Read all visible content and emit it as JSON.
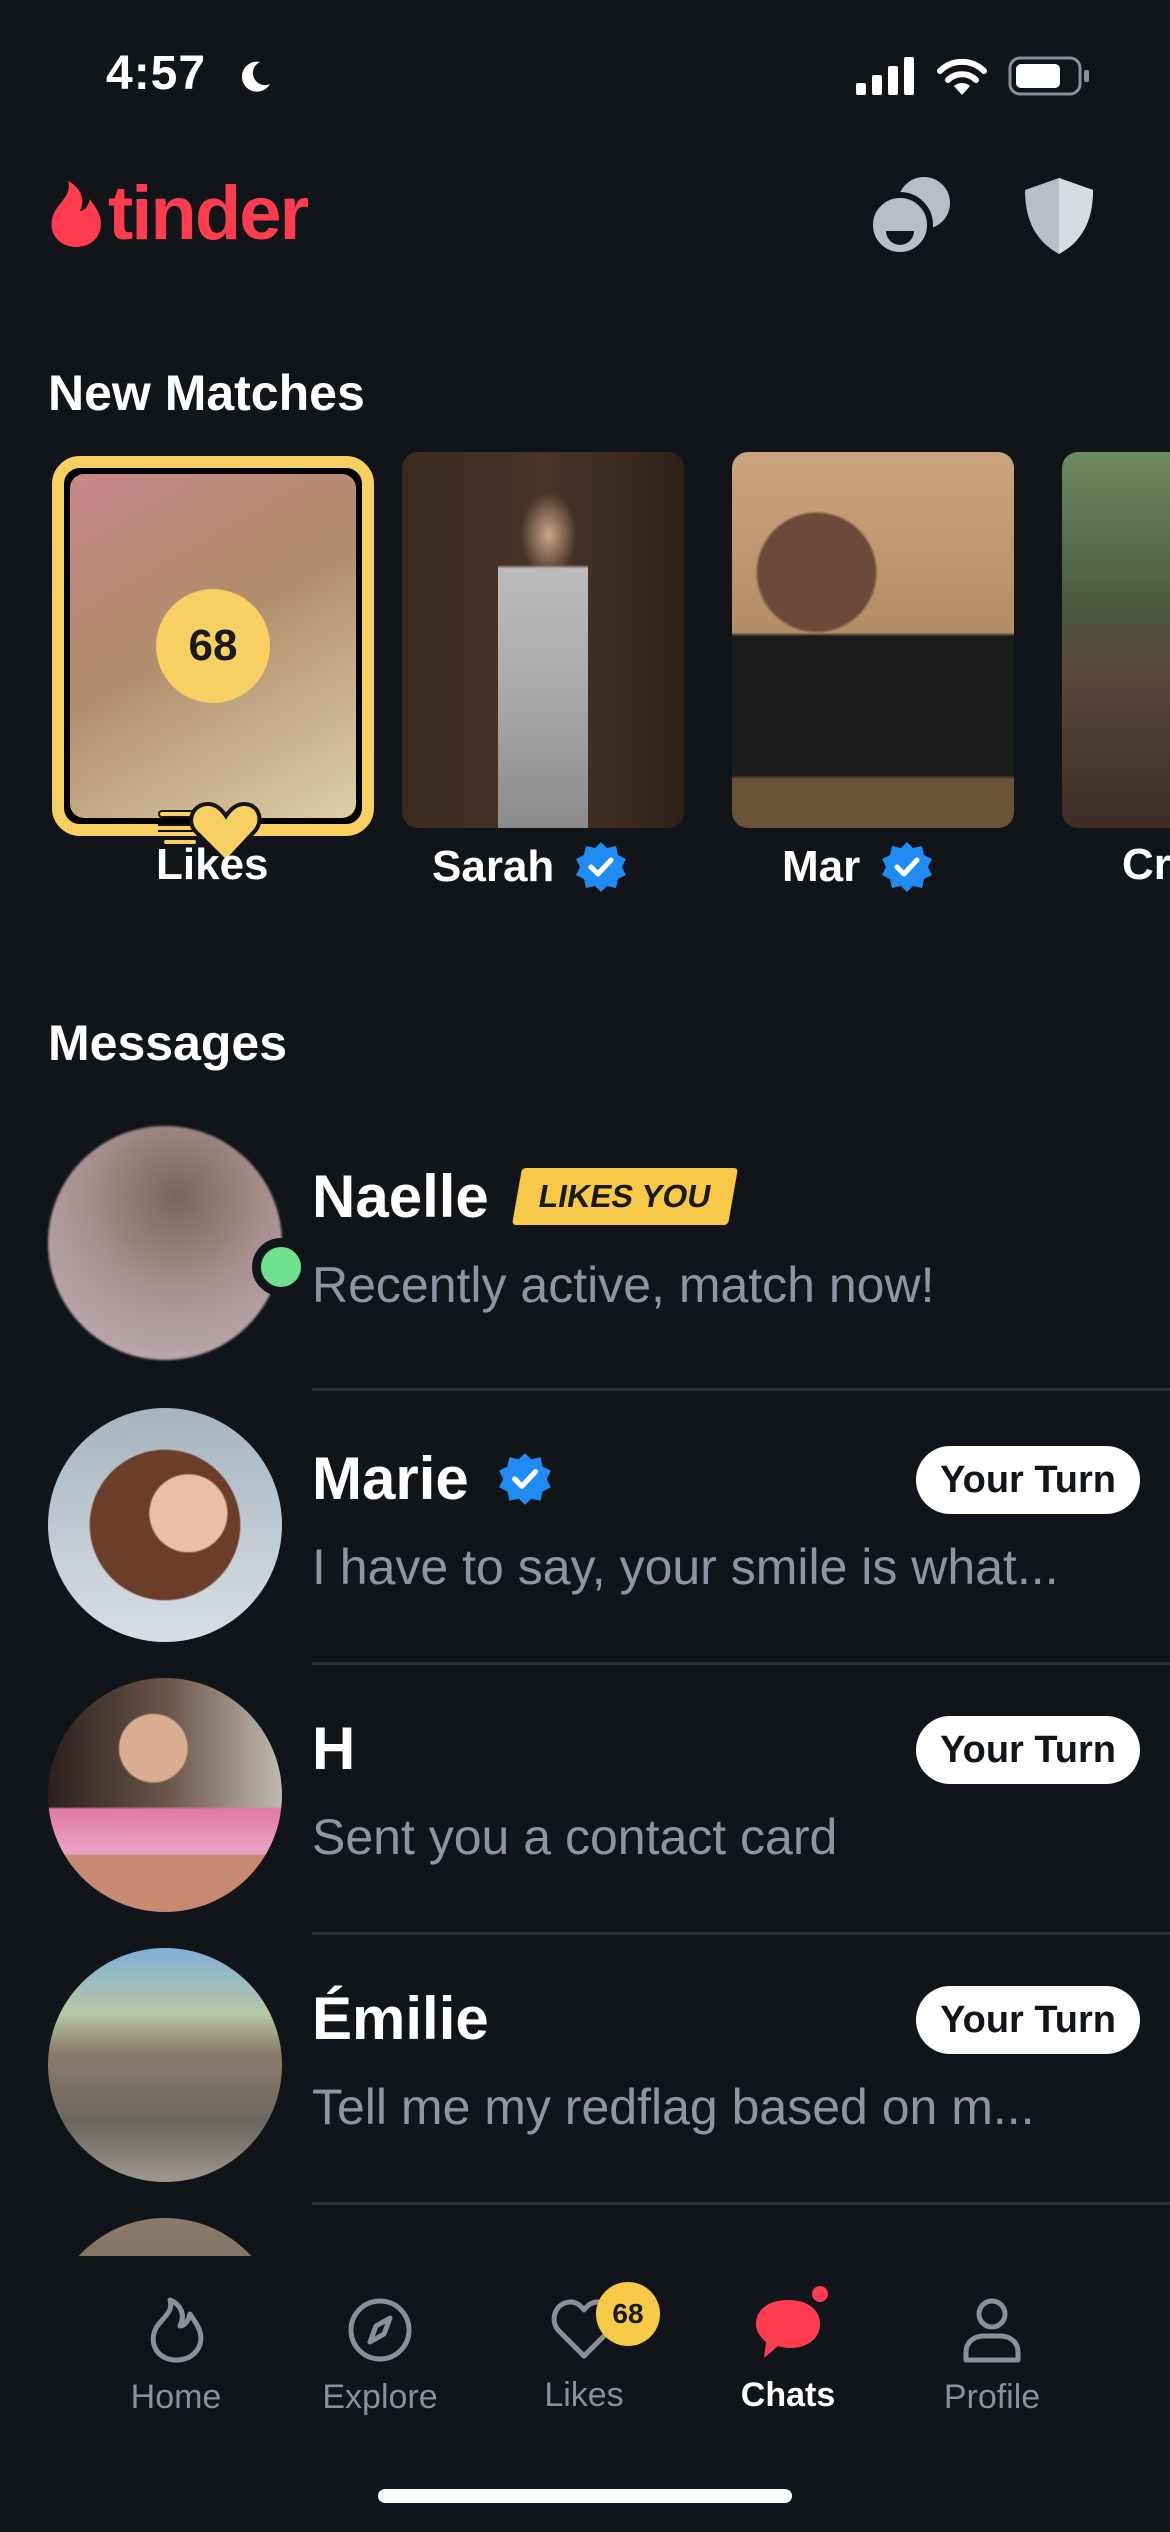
{
  "status_bar": {
    "time": "4:57"
  },
  "header": {
    "logo_text": "tinder"
  },
  "new_matches": {
    "title": "New Matches",
    "likes_card": {
      "count": "68",
      "label": "Likes"
    },
    "matches": [
      {
        "name": "Sarah",
        "verified": true
      },
      {
        "name": "Mar",
        "verified": true
      },
      {
        "name": "Cr",
        "verified": false
      }
    ]
  },
  "messages": {
    "title": "Messages",
    "items": [
      {
        "name": "Naelle",
        "badge": "LIKES YOU",
        "preview": "Recently active, match now!",
        "online": true
      },
      {
        "name": "Marie",
        "verified": true,
        "status": "Your Turn",
        "preview": "I have to say, your smile is what..."
      },
      {
        "name": "H",
        "status": "Your Turn",
        "preview": "Sent you a contact card"
      },
      {
        "name": "Émilie",
        "status": "Your Turn",
        "preview": "Tell me my redflag based on m..."
      }
    ]
  },
  "tab_bar": {
    "tabs": [
      {
        "label": "Home",
        "icon": "flame-icon"
      },
      {
        "label": "Explore",
        "icon": "compass-icon"
      },
      {
        "label": "Likes",
        "icon": "heart-icon",
        "badge": "68"
      },
      {
        "label": "Chats",
        "icon": "chat-bubble-icon",
        "active": true
      },
      {
        "label": "Profile",
        "icon": "person-icon"
      }
    ]
  },
  "colors": {
    "brand": "#fd3c4f",
    "gold": "#f7cf62",
    "background": "#111418",
    "online": "#6fe08e",
    "verified": "#1f8bf3"
  }
}
